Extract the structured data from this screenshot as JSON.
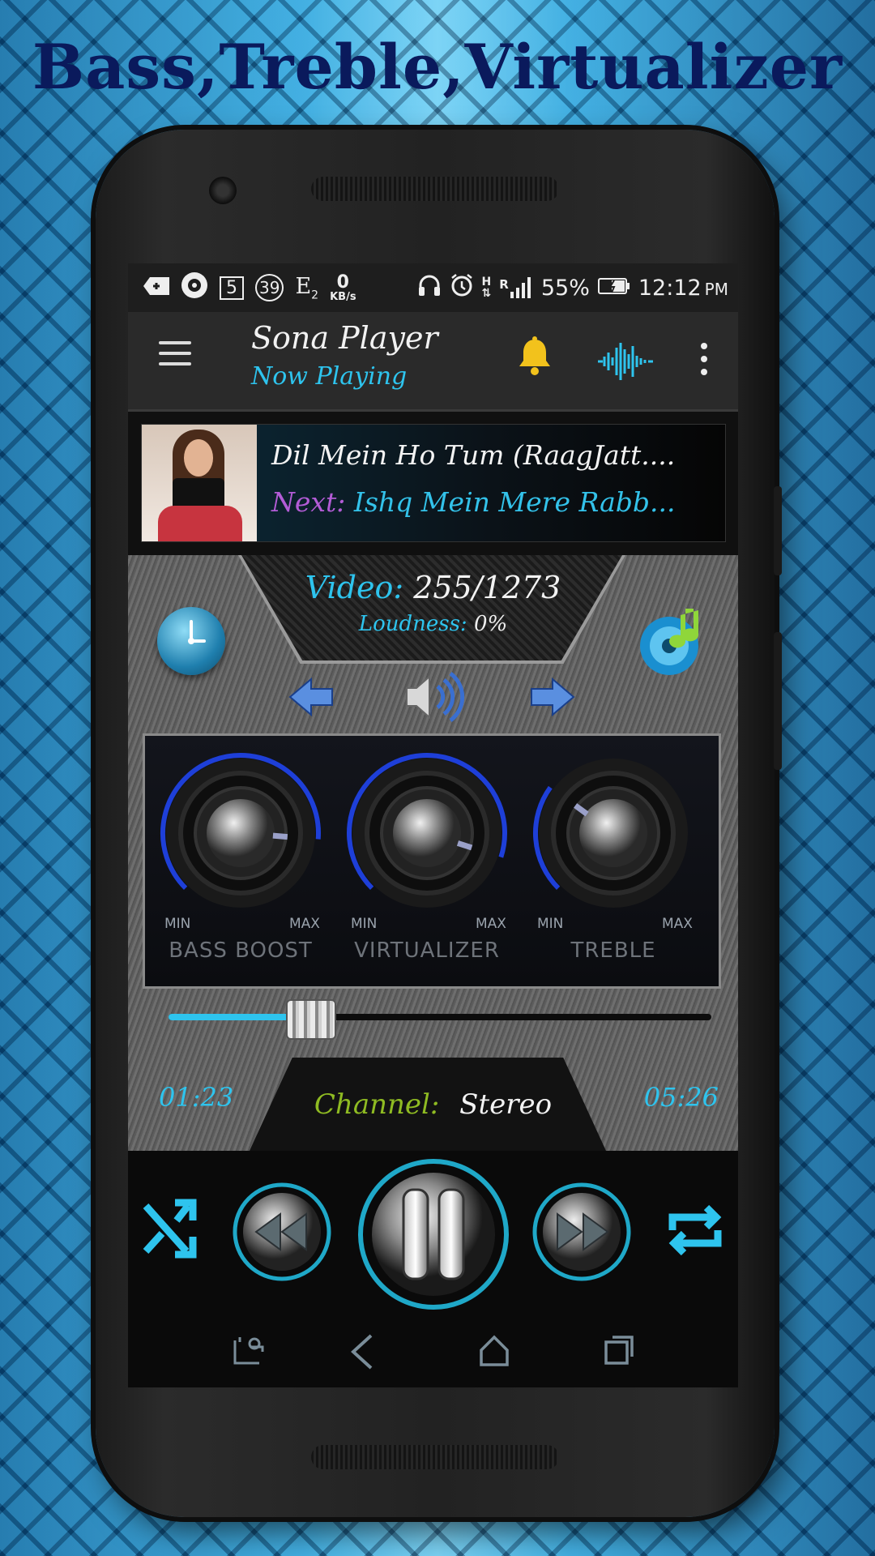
{
  "headline": "Bass,Treble,Virtualizer",
  "status_bar": {
    "box_number": "5",
    "circle_number": "39",
    "e_indicator": "E",
    "e_sub": "2",
    "data_rate": "0",
    "data_unit": "KB/s",
    "net_h": "H",
    "net_r": "R",
    "battery": "55%",
    "time": "12:12",
    "ampm": "PM"
  },
  "app_bar": {
    "title": "Sona Player",
    "subtitle": "Now Playing"
  },
  "now_playing": {
    "song": "Dil Mein Ho Tum (RaagJatt....",
    "next_label": "Next:",
    "next_song": "Ishq Mein Mere Rabb..."
  },
  "info": {
    "video_label": "Video:",
    "video_value": "255/1273",
    "loudness_label": "Loudness:",
    "loudness_value": "0%"
  },
  "knobs": [
    {
      "label": "BASS BOOST",
      "min": "MIN",
      "max": "MAX",
      "level": 0.85
    },
    {
      "label": "VIRTUALIZER",
      "min": "MIN",
      "max": "MAX",
      "level": 0.9
    },
    {
      "label": "TREBLE",
      "min": "MIN",
      "max": "MAX",
      "level": 0.3
    }
  ],
  "seek": {
    "progress": 0.26,
    "elapsed": "01:23",
    "total": "05:26"
  },
  "channel": {
    "label": "Channel:",
    "value": "Stereo"
  },
  "colors": {
    "accent": "#2ec4ee",
    "knob_arc": "#1e3fd8",
    "next_label": "#b35cd6",
    "channel_label": "#8fbb22",
    "bell": "#f2c21c"
  }
}
